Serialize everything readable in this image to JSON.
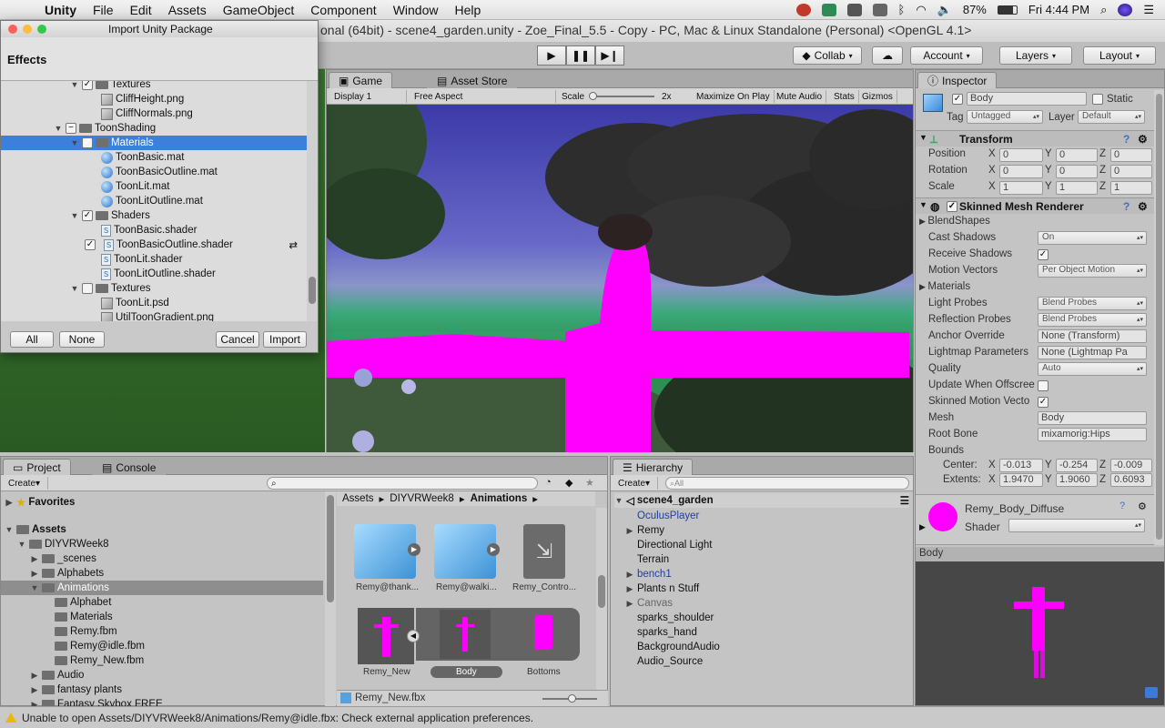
{
  "menubar": {
    "app": "Unity",
    "items": [
      "File",
      "Edit",
      "Assets",
      "GameObject",
      "Component",
      "Window",
      "Help"
    ],
    "battery": "87%",
    "clock": "Fri 4:44 PM"
  },
  "window_title": "onal (64bit) - scene4_garden.unity - Zoe_Final_5.5 - Copy - PC, Mac & Linux Standalone (Personal) <OpenGL 4.1>",
  "toolbar": {
    "collab": "Collab",
    "account": "Account",
    "layers": "Layers",
    "layout": "Layout"
  },
  "import_dialog": {
    "title": "Import Unity Package",
    "heading": "Effects",
    "tree": [
      {
        "label": "Textures",
        "depth": 2,
        "type": "folder"
      },
      {
        "label": "CliffHeight.png",
        "depth": 3,
        "type": "image"
      },
      {
        "label": "CliffNormals.png",
        "depth": 3,
        "type": "image"
      },
      {
        "label": "ToonShading",
        "depth": 1,
        "type": "folder"
      },
      {
        "label": "Materials",
        "depth": 2,
        "type": "folder"
      },
      {
        "label": "ToonBasic.mat",
        "depth": 3,
        "type": "mat"
      },
      {
        "label": "ToonBasicOutline.mat",
        "depth": 3,
        "type": "mat"
      },
      {
        "label": "ToonLit.mat",
        "depth": 3,
        "type": "mat"
      },
      {
        "label": "ToonLitOutline.mat",
        "depth": 3,
        "type": "mat"
      },
      {
        "label": "Shaders",
        "depth": 2,
        "type": "folder"
      },
      {
        "label": "ToonBasic.shader",
        "depth": 3,
        "type": "shader"
      },
      {
        "label": "ToonBasicOutline.shader",
        "depth": 3,
        "type": "shader"
      },
      {
        "label": "ToonLit.shader",
        "depth": 3,
        "type": "shader"
      },
      {
        "label": "ToonLitOutline.shader",
        "depth": 3,
        "type": "shader"
      },
      {
        "label": "Textures",
        "depth": 2,
        "type": "folder"
      },
      {
        "label": "ToonLit.psd",
        "depth": 3,
        "type": "image"
      },
      {
        "label": "UtilToonGradient.png",
        "depth": 3,
        "type": "image"
      }
    ],
    "buttons": {
      "all": "All",
      "none": "None",
      "cancel": "Cancel",
      "import": "Import"
    }
  },
  "game": {
    "tabs": {
      "game": "Game",
      "store": "Asset Store"
    },
    "display": "Display 1",
    "aspect": "Free Aspect",
    "scale_label": "Scale",
    "scale_value": "2x",
    "toggles": [
      "Maximize On Play",
      "Mute Audio",
      "Stats",
      "Gizmos"
    ]
  },
  "inspector": {
    "tab": "Inspector",
    "name": "Body",
    "static": "Static",
    "tag_label": "Tag",
    "tag": "Untagged",
    "layer_label": "Layer",
    "layer": "Default",
    "transform": {
      "title": "Transform",
      "rows": [
        {
          "label": "Position",
          "x": "0",
          "y": "0",
          "z": "0"
        },
        {
          "label": "Rotation",
          "x": "0",
          "y": "0",
          "z": "0"
        },
        {
          "label": "Scale",
          "x": "1",
          "y": "1",
          "z": "1"
        }
      ]
    },
    "smr": {
      "title": "Skinned Mesh Renderer",
      "blend_shapes": "BlendShapes",
      "props": [
        {
          "label": "Cast Shadows",
          "value": "On",
          "kind": "drop"
        },
        {
          "label": "Receive Shadows",
          "value": "✓",
          "kind": "check"
        },
        {
          "label": "Motion Vectors",
          "value": "Per Object Motion",
          "kind": "drop"
        },
        {
          "label": "Materials",
          "value": "",
          "kind": "fold"
        },
        {
          "label": "Light Probes",
          "value": "Blend Probes",
          "kind": "drop"
        },
        {
          "label": "Reflection Probes",
          "value": "Blend Probes",
          "kind": "drop"
        },
        {
          "label": "Anchor Override",
          "value": "None (Transform)",
          "kind": "field"
        },
        {
          "label": "Lightmap Parameters",
          "value": "None (Lightmap Pa",
          "kind": "field"
        },
        {
          "label": "Quality",
          "value": "Auto",
          "kind": "drop"
        },
        {
          "label": "Update When Offscree",
          "value": "",
          "kind": "check"
        },
        {
          "label": "Skinned Motion Vecto",
          "value": "✓",
          "kind": "check"
        },
        {
          "label": "Mesh",
          "value": "Body",
          "kind": "field"
        },
        {
          "label": "Root Bone",
          "value": "mixamorig:Hips",
          "kind": "field"
        }
      ],
      "bounds": "Bounds",
      "center_label": "Center:",
      "center": {
        "x": "-0.013",
        "y": "-0.254",
        "z": "-0.009"
      },
      "extents_label": "Extents:",
      "extents": {
        "x": "1.9470",
        "y": "1.9060",
        "z": "0.6093"
      }
    },
    "material": {
      "name": "Remy_Body_Diffuse",
      "shader_label": "Shader",
      "color": "#ff00ff"
    },
    "preview_title": "Body"
  },
  "project": {
    "tabs": {
      "project": "Project",
      "console": "Console"
    },
    "create": "Create",
    "favorites": "Favorites",
    "tree": [
      {
        "label": "Assets",
        "depth": 0
      },
      {
        "label": "DIYVRWeek8",
        "depth": 1
      },
      {
        "label": "_scenes",
        "depth": 2
      },
      {
        "label": "Alphabets",
        "depth": 2
      },
      {
        "label": "Animations",
        "depth": 2
      },
      {
        "label": "Alphabet",
        "depth": 3
      },
      {
        "label": "Materials",
        "depth": 3
      },
      {
        "label": "Remy.fbm",
        "depth": 3
      },
      {
        "label": "Remy@idle.fbm",
        "depth": 3
      },
      {
        "label": "Remy_New.fbm",
        "depth": 3
      },
      {
        "label": "Audio",
        "depth": 2
      },
      {
        "label": "fantasy plants",
        "depth": 2
      },
      {
        "label": "Fantasy Skybox FREE",
        "depth": 2
      }
    ],
    "breadcrumb": [
      "Assets",
      "DIYVRWeek8",
      "Animations"
    ],
    "assets": [
      {
        "label": "Remy@thank..."
      },
      {
        "label": "Remy@walki..."
      },
      {
        "label": "Remy_Contro..."
      }
    ],
    "sub_assets": [
      {
        "label": "Remy_New"
      },
      {
        "label": "Body"
      },
      {
        "label": "Bottoms"
      }
    ],
    "selected_file": "Remy_New.fbx"
  },
  "hierarchy": {
    "tab": "Hierarchy",
    "create": "Create",
    "search_placeholder": "All",
    "scene": "scene4_garden",
    "items": [
      {
        "label": "OculusPlayer",
        "prefab": true,
        "fold": false
      },
      {
        "label": "Remy",
        "prefab": false,
        "fold": true
      },
      {
        "label": "Directional Light",
        "prefab": false,
        "fold": false
      },
      {
        "label": "Terrain",
        "prefab": false,
        "fold": false
      },
      {
        "label": "bench1",
        "prefab": true,
        "fold": true
      },
      {
        "label": "Plants n Stuff",
        "prefab": false,
        "fold": true
      },
      {
        "label": "Canvas",
        "prefab": false,
        "fold": true,
        "dim": true
      },
      {
        "label": "sparks_shoulder",
        "prefab": false,
        "fold": false
      },
      {
        "label": "sparks_hand",
        "prefab": false,
        "fold": false
      },
      {
        "label": "BackgroundAudio",
        "prefab": false,
        "fold": false
      },
      {
        "label": "Audio_Source",
        "prefab": false,
        "fold": false
      }
    ]
  },
  "status": "Unable to open Assets/DIYVRWeek8/Animations/Remy@idle.fbx: Check external application preferences.",
  "colors": {
    "accent": "#3d7fdb",
    "magenta": "#ff00ff"
  }
}
